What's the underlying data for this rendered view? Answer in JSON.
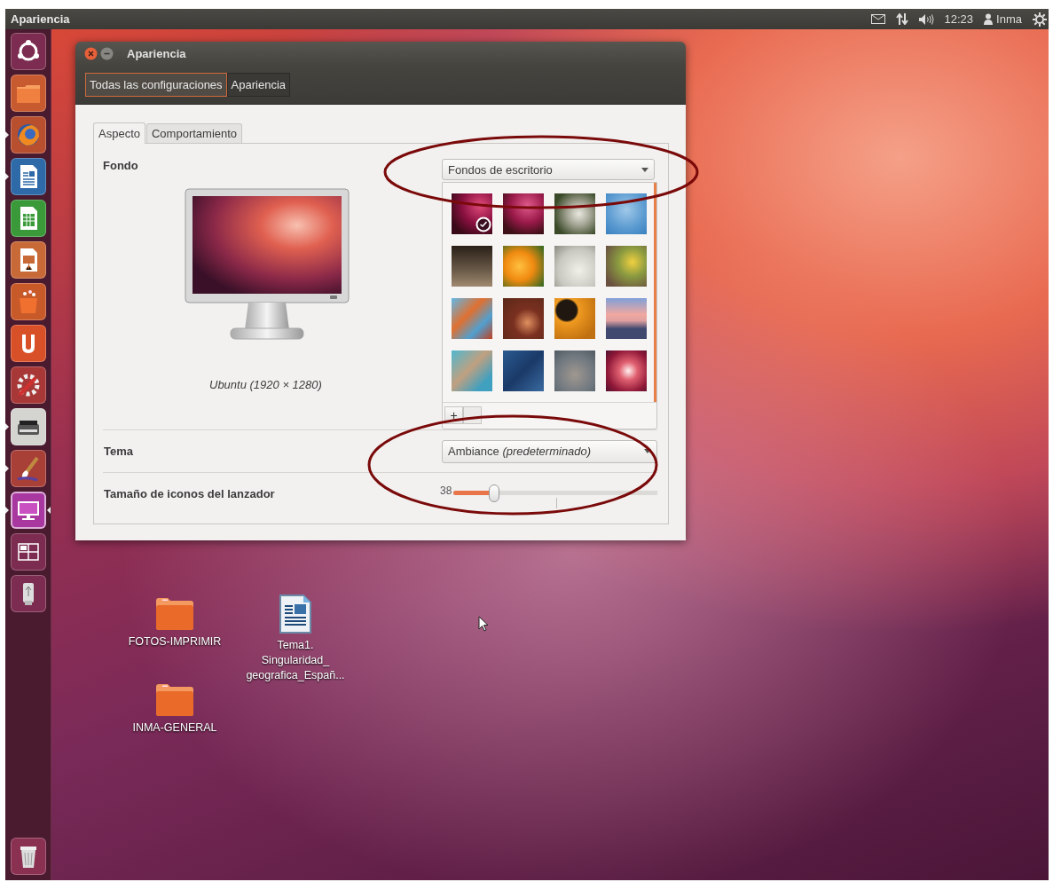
{
  "panel": {
    "app_title": "Apariencia",
    "clock": "12:23",
    "user": "Inma"
  },
  "launcher": [
    {
      "kind": "dash",
      "running": false,
      "focused": false
    },
    {
      "kind": "files",
      "running": false,
      "focused": false
    },
    {
      "kind": "browser",
      "running": true,
      "focused": false
    },
    {
      "kind": "writer",
      "running": true,
      "focused": false
    },
    {
      "kind": "calc",
      "running": false,
      "focused": false
    },
    {
      "kind": "impress",
      "running": false,
      "focused": false
    },
    {
      "kind": "software",
      "running": false,
      "focused": false
    },
    {
      "kind": "cloud",
      "running": false,
      "focused": false
    },
    {
      "kind": "settings",
      "running": false,
      "focused": false
    },
    {
      "kind": "scanner",
      "running": true,
      "focused": false
    },
    {
      "kind": "paint",
      "running": true,
      "focused": false
    },
    {
      "kind": "display",
      "running": true,
      "focused": true
    },
    {
      "kind": "workspaces",
      "running": false,
      "focused": false
    },
    {
      "kind": "usb",
      "running": false,
      "focused": false
    }
  ],
  "window": {
    "title": "Apariencia",
    "breadcrumbs": [
      {
        "label": "Todas las configuraciones",
        "selected": true
      },
      {
        "label": "Apariencia",
        "selected": false
      }
    ],
    "tabs": [
      {
        "label": "Aspecto",
        "selected": true
      },
      {
        "label": "Comportamiento",
        "selected": false
      }
    ],
    "background": {
      "label": "Fondo",
      "preview_caption": "Ubuntu (1920 × 1280)",
      "source": "Fondos de escritorio",
      "add_button": "+",
      "wallpapers": [
        {
          "selected": true
        },
        {
          "selected": false
        },
        {
          "selected": false
        },
        {
          "selected": false
        },
        {
          "selected": false
        },
        {
          "selected": false
        },
        {
          "selected": false
        },
        {
          "selected": false
        },
        {
          "selected": false
        },
        {
          "selected": false
        },
        {
          "selected": false
        },
        {
          "selected": false
        },
        {
          "selected": false
        },
        {
          "selected": false
        },
        {
          "selected": false
        },
        {
          "selected": false
        }
      ]
    },
    "theme": {
      "label": "Tema",
      "value": "Ambiance *(predeterminado)*"
    },
    "icon_size": {
      "label": "Tamaño de iconos del lanzador",
      "reading": "38",
      "level": 0.2
    }
  },
  "desktop_icons": [
    {
      "kind": "folder",
      "label": "FOTOS-IMPRIMIR"
    },
    {
      "kind": "document",
      "label": "Tema1. Singularidad_ geografica_Españ..."
    },
    {
      "kind": "folder",
      "label": "INMA-GENERAL"
    }
  ]
}
